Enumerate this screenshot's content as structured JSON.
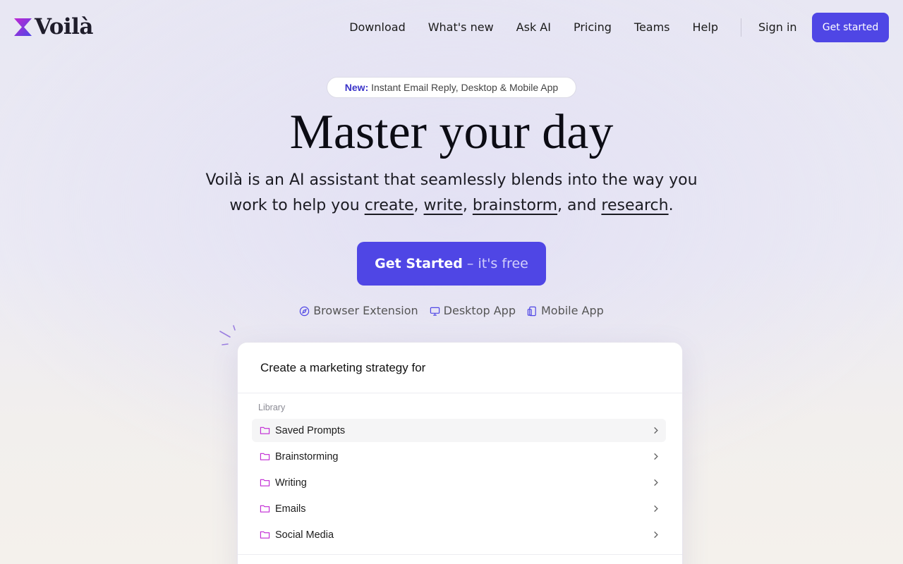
{
  "brand": {
    "name": "Voilà",
    "accent": "#4f46e5"
  },
  "nav": {
    "links": [
      "Download",
      "What's new",
      "Ask AI",
      "Pricing",
      "Teams",
      "Help"
    ],
    "sign_in": "Sign in",
    "get_started": "Get started"
  },
  "hero": {
    "pill_new": "New:",
    "pill_text": "Instant Email Reply, Desktop & Mobile App",
    "title": "Master your day",
    "subtitle_line1": "Voilà is an AI assistant that seamlessly blends into the way you",
    "subtitle_pre": "work to help you ",
    "link_create": "create",
    "comma1": ", ",
    "link_write": "write",
    "comma2": ", ",
    "link_brainstorm": "brainstorm",
    "and": ", and ",
    "link_research": "research",
    "period": ".",
    "cta_main": "Get Started",
    "cta_sub": " – it's free",
    "platforms": [
      {
        "label": "Browser Extension",
        "icon": "compass-icon"
      },
      {
        "label": "Desktop App",
        "icon": "monitor-icon"
      },
      {
        "label": "Mobile App",
        "icon": "mobile-icon"
      }
    ]
  },
  "card": {
    "prompt": "Create a marketing strategy for",
    "library_label": "Library",
    "items": [
      {
        "label": "Saved Prompts",
        "icon": "folder-icon"
      },
      {
        "label": "Brainstorming",
        "icon": "folder-icon"
      },
      {
        "label": "Writing",
        "icon": "folder-icon"
      },
      {
        "label": "Emails",
        "icon": "folder-icon"
      },
      {
        "label": "Social Media",
        "icon": "folder-icon"
      }
    ]
  }
}
